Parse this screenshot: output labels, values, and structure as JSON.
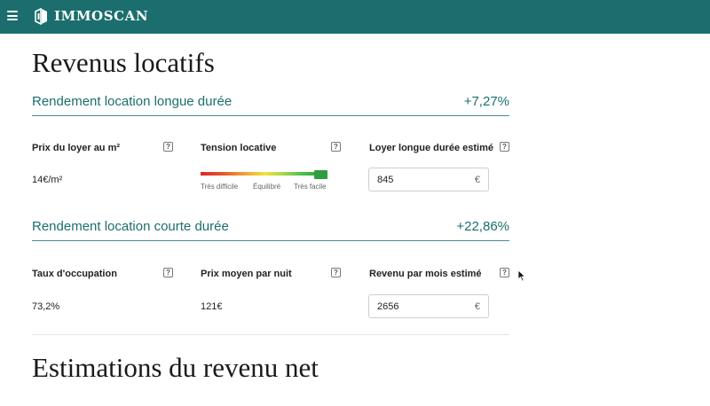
{
  "header": {
    "brand": "IMMOSCAN",
    "colors": {
      "bar": "#1c6e6e",
      "text": "#ffffff"
    }
  },
  "page": {
    "title": "Revenus locatifs",
    "next_title": "Estimations du revenu net"
  },
  "long_term": {
    "title": "Rendement location longue durée",
    "yield": "+7,27%",
    "rent_per_m2": {
      "label": "Prix du loyer au m²",
      "value": "14€/m²"
    },
    "rental_tension": {
      "label": "Tension locative",
      "scale": [
        "Très difficile",
        "Équilibré",
        "Très facile"
      ],
      "level": 1.0
    },
    "estimated_rent": {
      "label": "Loyer longue durée estimé",
      "value": "845",
      "unit": "€"
    }
  },
  "short_term": {
    "title": "Rendement location courte durée",
    "yield": "+22,86%",
    "occupancy": {
      "label": "Taux d'occupation",
      "value": "73,2%"
    },
    "avg_night_price": {
      "label": "Prix moyen par nuit",
      "value": "121€"
    },
    "estimated_monthly": {
      "label": "Revenu par mois estimé",
      "value": "2656",
      "unit": "€"
    }
  },
  "help_icon_glyph": "?"
}
